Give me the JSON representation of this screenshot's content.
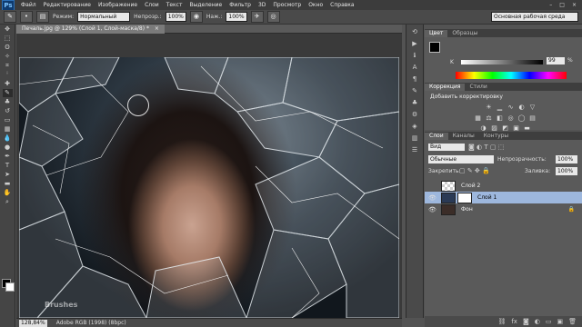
{
  "menubar": {
    "logo": "Ps",
    "items": [
      "Файл",
      "Редактирование",
      "Изображение",
      "Слои",
      "Текст",
      "Выделение",
      "Фильтр",
      "3D",
      "Просмотр",
      "Окно",
      "Справка"
    ],
    "window_controls": [
      "–",
      "□",
      "×"
    ]
  },
  "options": {
    "mode_label": "Режим:",
    "mode_value": "Нормальный",
    "opacity_label": "Непрозр.:",
    "opacity_value": "100%",
    "flow_label": "Наж.:",
    "flow_value": "100%",
    "workspace": "Основная рабочая среда"
  },
  "document": {
    "tab_title": "Печаль.jpg @ 129% (Слой 1, Слой-маска/8) *",
    "close": "×"
  },
  "status": {
    "zoom": "128,84%",
    "profile": "Adobe RGB (1998) (8bpc)"
  },
  "watermark": "Brushes",
  "color_panel": {
    "tabs": [
      "Цвет",
      "Образцы"
    ],
    "k_label": "K",
    "k_value": "99",
    "k_unit": "%"
  },
  "corrections_panel": {
    "tabs": [
      "Коррекция",
      "Стили"
    ],
    "hint": "Добавить корректировку"
  },
  "layers_panel": {
    "tabs": [
      "Слои",
      "Каналы",
      "Контуры"
    ],
    "kind_filter": "Вид",
    "blend_mode": "Обычные",
    "opacity_label": "Непрозрачность:",
    "opacity_value": "100%",
    "lock_label": "Закрепить:",
    "fill_label": "Заливка:",
    "fill_value": "100%",
    "layers": [
      {
        "name": "Слой 2",
        "visible": false
      },
      {
        "name": "Слой 1",
        "visible": true,
        "active": true
      },
      {
        "name": "Фон",
        "visible": true,
        "locked": true
      }
    ],
    "footer_icons": [
      "link-icon",
      "fx-icon",
      "mask-icon",
      "adjust-icon",
      "folder-icon",
      "new-layer-icon",
      "trash-icon"
    ]
  },
  "colors": {
    "accent": "#9db7dd",
    "foreground": "#000000",
    "background": "#ffffff"
  }
}
